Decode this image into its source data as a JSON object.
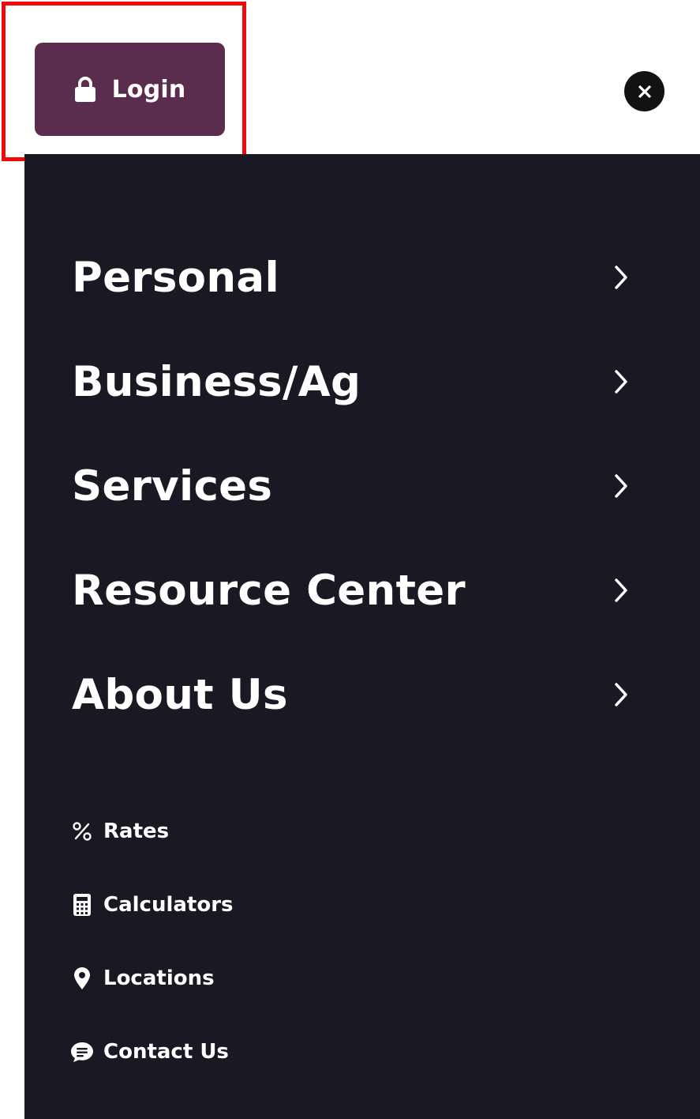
{
  "header": {
    "login_label": "Login",
    "login_button_color": "#5a2d4e",
    "close_icon": "close-icon",
    "highlight_color": "#ee0a0a"
  },
  "menu": {
    "background_color": "#1b1723",
    "primary_items": [
      {
        "label": "Personal",
        "icon": "chevron-right-icon"
      },
      {
        "label": "Business/Ag",
        "icon": "chevron-right-icon"
      },
      {
        "label": "Services",
        "icon": "chevron-right-icon"
      },
      {
        "label": "Resource Center",
        "icon": "chevron-right-icon"
      },
      {
        "label": "About Us",
        "icon": "chevron-right-icon"
      }
    ],
    "secondary_items": [
      {
        "label": "Rates",
        "icon": "percent-icon"
      },
      {
        "label": "Calculators",
        "icon": "calculator-icon"
      },
      {
        "label": "Locations",
        "icon": "map-pin-icon"
      },
      {
        "label": "Contact Us",
        "icon": "chat-bubble-icon"
      }
    ]
  }
}
